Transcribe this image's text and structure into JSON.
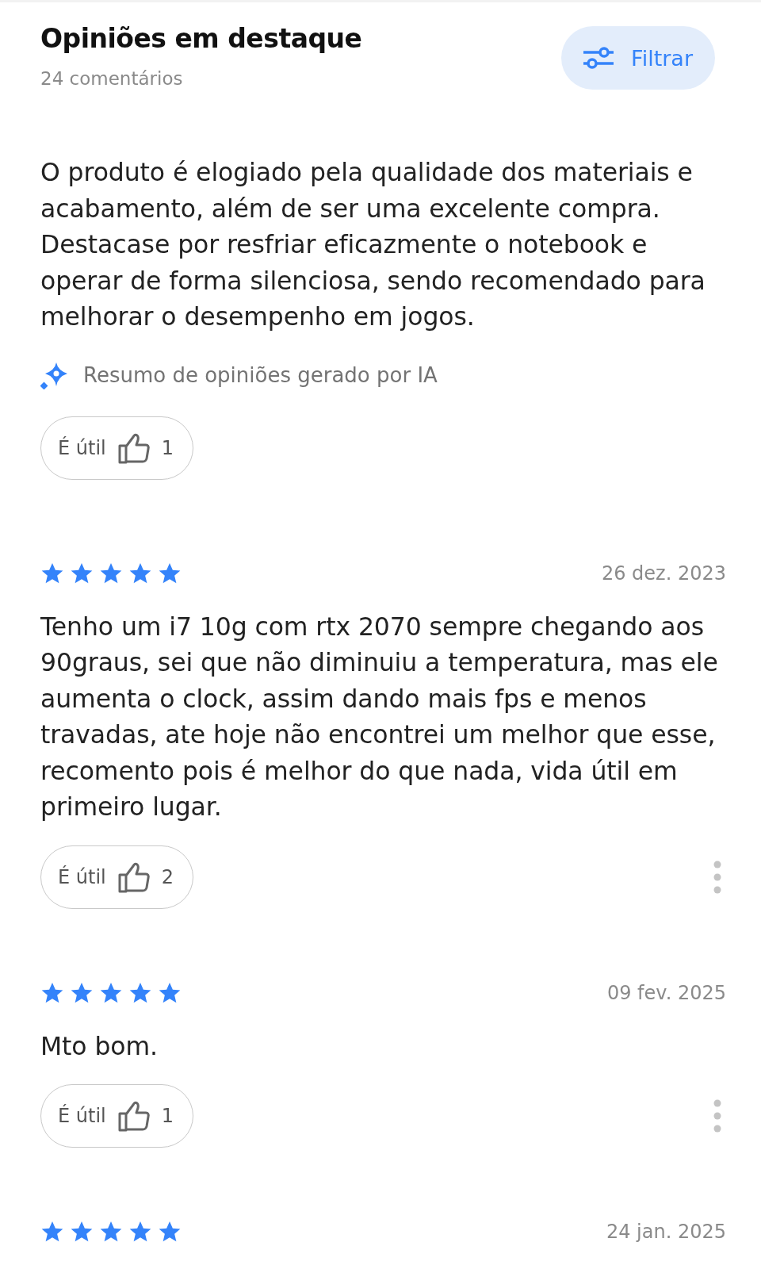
{
  "header": {
    "title": "Opiniões em destaque",
    "count": "24 comentários",
    "filter_button": "Filtrar"
  },
  "summary": {
    "text": "O produto é elogiado pela qualidade dos materiais e acabamento, além de ser uma excelente compra. Destacase por resfriar eficazmente o notebook e operar de forma silenciosa, sendo recomendado para melhorar o desempenho em jogos.",
    "ai_label": "Resumo de opiniões gerado por IA",
    "helpful": {
      "label": "É útil",
      "count": "1"
    }
  },
  "reviews": [
    {
      "stars": 5,
      "date": "26 dez. 2023",
      "text": "Tenho um i7 10g com rtx 2070 sempre chegando aos 90graus, sei que não diminuiu a temperatura, mas ele aumenta o clock, assim dando mais fps e menos travadas, ate hoje não encontrei um melhor que esse, recomento pois é melhor do que nada, vida útil em primeiro lugar.",
      "helpful": {
        "label": "É útil",
        "count": "2"
      }
    },
    {
      "stars": 5,
      "date": "09 fev. 2025",
      "text": "Mto bom.",
      "helpful": {
        "label": "É útil",
        "count": "1"
      }
    },
    {
      "stars": 5,
      "date": "24 jan. 2025"
    }
  ]
}
